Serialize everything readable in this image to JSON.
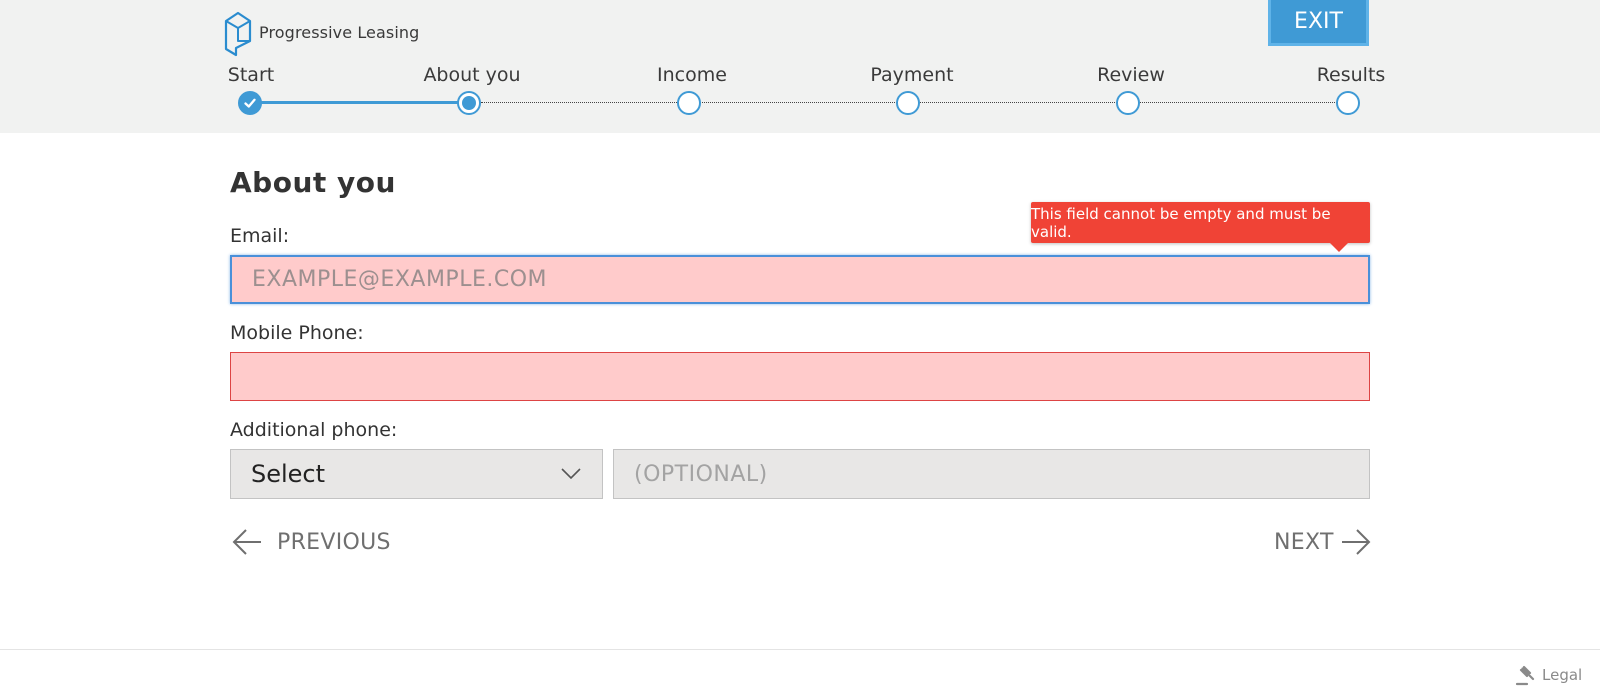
{
  "header": {
    "brand": "Progressive Leasing",
    "exit_label": "EXIT"
  },
  "steps": [
    {
      "label": "Start",
      "state": "done"
    },
    {
      "label": "About you",
      "state": "current"
    },
    {
      "label": "Income",
      "state": "todo"
    },
    {
      "label": "Payment",
      "state": "todo"
    },
    {
      "label": "Review",
      "state": "todo"
    },
    {
      "label": "Results",
      "state": "todo"
    }
  ],
  "form": {
    "title": "About you",
    "email_label": "Email:",
    "email_placeholder": "EXAMPLE@EXAMPLE.COM",
    "email_error": "This field cannot be empty and must be valid.",
    "mobile_label": "Mobile Phone:",
    "mobile_value": "",
    "additional_label": "Additional phone:",
    "select_value": "Select",
    "optional_placeholder": "(OPTIONAL)"
  },
  "nav": {
    "previous_label": "PREVIOUS",
    "next_label": "NEXT"
  },
  "footer": {
    "legal_label": "Legal"
  },
  "colors": {
    "accent": "#3f9ad5",
    "error_bg": "#ffcbcb",
    "tooltip": "#f04336"
  }
}
